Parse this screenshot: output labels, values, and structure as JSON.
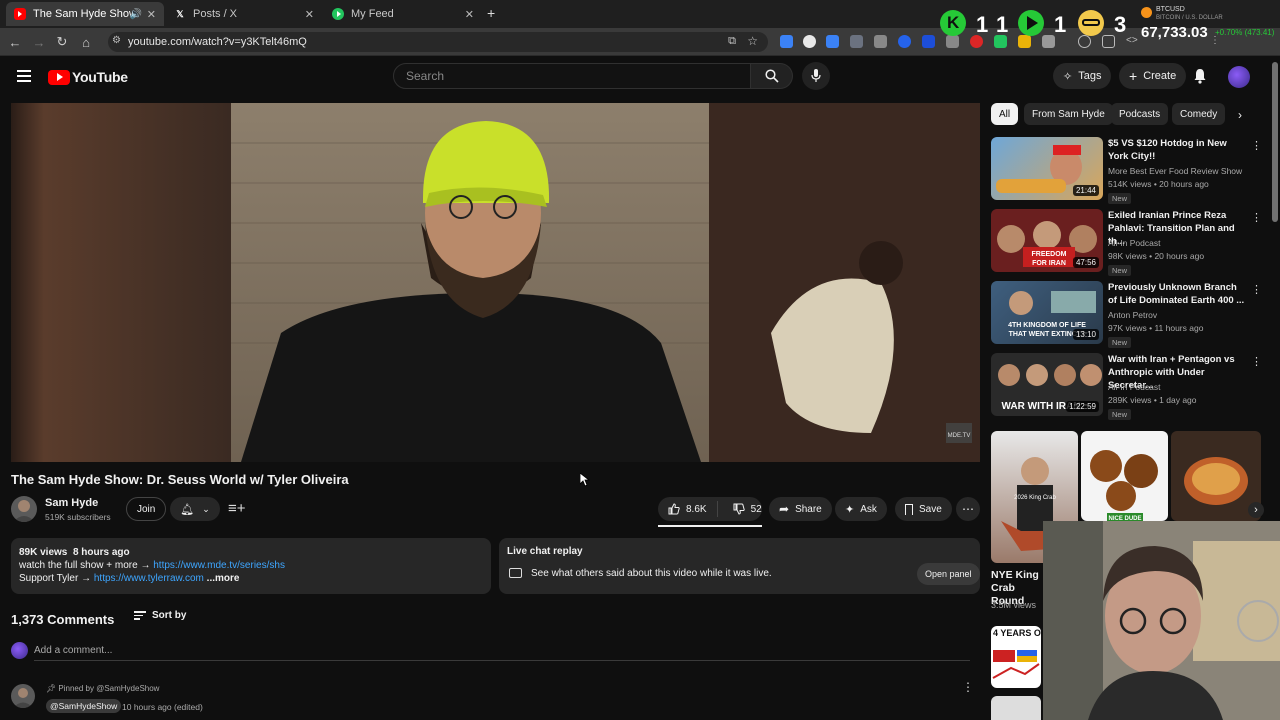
{
  "browser": {
    "tabs": [
      {
        "label": "The Sam Hyde Show: Dr. Se",
        "icon": "youtube-icon",
        "active": true
      },
      {
        "label": "Posts / X",
        "icon": "x-icon",
        "active": false
      },
      {
        "label": "My Feed",
        "icon": "play-icon",
        "active": false
      }
    ],
    "url": "youtube.com/watch?v=y3KTelt46mQ"
  },
  "ticker": {
    "counts": [
      "1",
      "1",
      "1",
      "3"
    ],
    "symbol": "BTCUSD",
    "pair": "BITCOIN / U.S. DOLLAR",
    "price": "67,733.03",
    "change": "+0.70% (473.41)",
    "colors": {
      "green": "#26c937",
      "yellow": "#f2c94c",
      "orange": "#f7931a"
    }
  },
  "header": {
    "logo_text": "YouTube",
    "search_placeholder": "Search",
    "tags_label": "Tags",
    "create_label": "Create"
  },
  "video": {
    "watermark": "MDE.TV",
    "title": "The Sam Hyde Show: Dr. Seuss World w/ Tyler Oliveira",
    "channel": "Sam Hyde",
    "subscribers": "519K subscribers",
    "join_label": "Join",
    "likes": "8.6K",
    "dislikes": "52",
    "share_label": "Share",
    "ask_label": "Ask",
    "save_label": "Save"
  },
  "description": {
    "views": "89K views",
    "age": "8 hours ago",
    "line1_text": "watch the full show + more →",
    "line1_link": "https://www.mde.tv/series/shs",
    "line2_text": "Support Tyler →",
    "line2_link": "https://www.tylerraw.com",
    "more": "...more"
  },
  "livechat": {
    "title": "Live chat replay",
    "text": "See what others said about this video while it was live.",
    "button": "Open panel"
  },
  "comments": {
    "count": "1,373 Comments",
    "sort_label": "Sort by",
    "add_placeholder": "Add a comment...",
    "pinned_label": "Pinned by @SamHydeShow",
    "pinned_author": "@SamHydeShow",
    "pinned_time": "10 hours ago (edited)"
  },
  "sidebar": {
    "chips": [
      "All",
      "From Sam Hyde",
      "Podcasts",
      "Comedy"
    ],
    "recommendations": [
      {
        "title": "$5 VS $120 Hotdog in New York City!!",
        "channel": "More Best Ever Food Review Show",
        "meta": "514K views • 20 hours ago",
        "badge": "New",
        "duration": "21:44",
        "color": "#7bb34a"
      },
      {
        "title": "Exiled Iranian Prince Reza Pahlavi: Transition Plan and th...",
        "channel": "All-In Podcast",
        "meta": "98K views • 20 hours ago",
        "badge": "New",
        "duration": "47:56",
        "color": "#b03030",
        "thumb_text": "FREEDOM FOR IRAN"
      },
      {
        "title": "Previously Unknown Branch of Life Dominated Earth 400 ...",
        "channel": "Anton Petrov",
        "meta": "97K views • 11 hours ago",
        "badge": "New",
        "duration": "13:10",
        "color": "#4a6a8a",
        "thumb_text": "4TH KINGDOM OF LIFE THAT WENT EXTINCT?"
      },
      {
        "title": "War with Iran + Pentagon vs Anthropic with Under Secretar...",
        "channel": "All-In Podcast",
        "meta": "289K views • 1 day ago",
        "badge": "New",
        "duration": "1:22:59",
        "color": "#5a4a3a",
        "thumb_text": "WAR WITH IRAN"
      }
    ],
    "shorts": [
      {
        "title": "NYE King Crab Round",
        "meta": "3.5M views",
        "thumb_text": "2026 King Crab"
      },
      {
        "title": "",
        "meta": "",
        "thumb_text": "NICE DUDE"
      },
      {
        "title": "",
        "meta": "",
        "thumb_text": ""
      }
    ],
    "last_item_text": "4 YEARS O"
  }
}
